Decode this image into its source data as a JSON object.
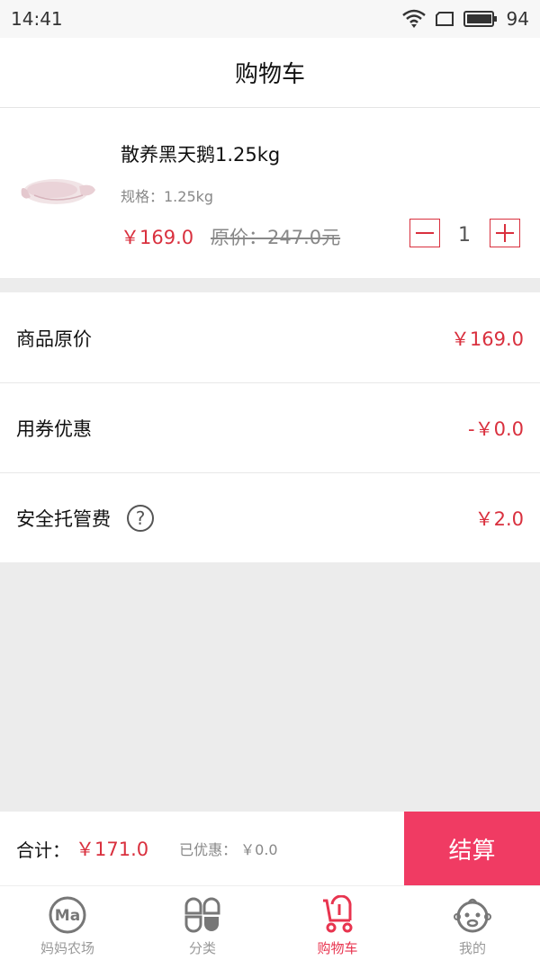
{
  "status": {
    "time": "14:41",
    "battery": "94"
  },
  "nav": {
    "title": "购物车"
  },
  "cart_item": {
    "name": "散养黑天鹅1.25kg",
    "spec": "规格：1.25kg",
    "price": "￥169.0",
    "original_price": "原价：247.0元",
    "quantity": "1"
  },
  "summary": {
    "original_label": "商品原价",
    "original_value": "￥169.0",
    "coupon_label": "用券优惠",
    "coupon_value": "-￥0.0",
    "custody_label": "安全托管费",
    "custody_help": "?",
    "custody_value": "￥2.0"
  },
  "checkout": {
    "total_label": "合计：",
    "total_value": "￥171.0",
    "discount_label": "已优惠：",
    "discount_value": "￥0.0",
    "button_label": "结算"
  },
  "tabs": [
    {
      "label": "妈妈农场",
      "icon": "ma-logo-icon",
      "active": false
    },
    {
      "label": "分类",
      "icon": "category-icon",
      "active": false
    },
    {
      "label": "购物车",
      "icon": "stroller-cart-icon",
      "active": true
    },
    {
      "label": "我的",
      "icon": "baby-face-icon",
      "active": false
    }
  ],
  "colors": {
    "accent": "#d9303e",
    "checkout_button": "#f03b63",
    "active_tab": "#e8344f"
  }
}
